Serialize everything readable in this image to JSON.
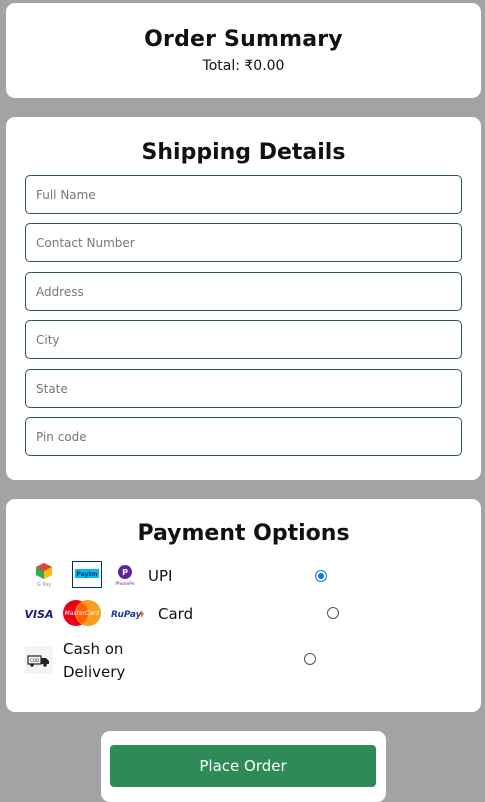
{
  "summary": {
    "title": "Order Summary",
    "total": "Total: ₹0.00"
  },
  "shipping": {
    "title": "Shipping Details",
    "fields": [
      {
        "placeholder": "Full Name",
        "value": ""
      },
      {
        "placeholder": "Contact Number",
        "value": ""
      },
      {
        "placeholder": "Address",
        "value": ""
      },
      {
        "placeholder": "City",
        "value": ""
      },
      {
        "placeholder": "State",
        "value": ""
      },
      {
        "placeholder": "Pin code",
        "value": ""
      }
    ]
  },
  "payment": {
    "title": "Payment Options",
    "options": [
      {
        "label": "UPI",
        "selected": true,
        "logos": [
          "GPay",
          "Paytm",
          "PhonePe"
        ]
      },
      {
        "label": "Card",
        "selected": false,
        "logos": [
          "VISA",
          "MasterCard",
          "RuPay"
        ]
      },
      {
        "label": "Cash on Delivery",
        "selected": false,
        "logos": [
          "COD"
        ]
      }
    ]
  },
  "place_order": {
    "label": "Place Order"
  },
  "colors": {
    "page_bg": "#a3a3a3",
    "accent": "#2e8b57",
    "input_border": "#2c5a43",
    "radio_selected": "#1a73e8"
  }
}
